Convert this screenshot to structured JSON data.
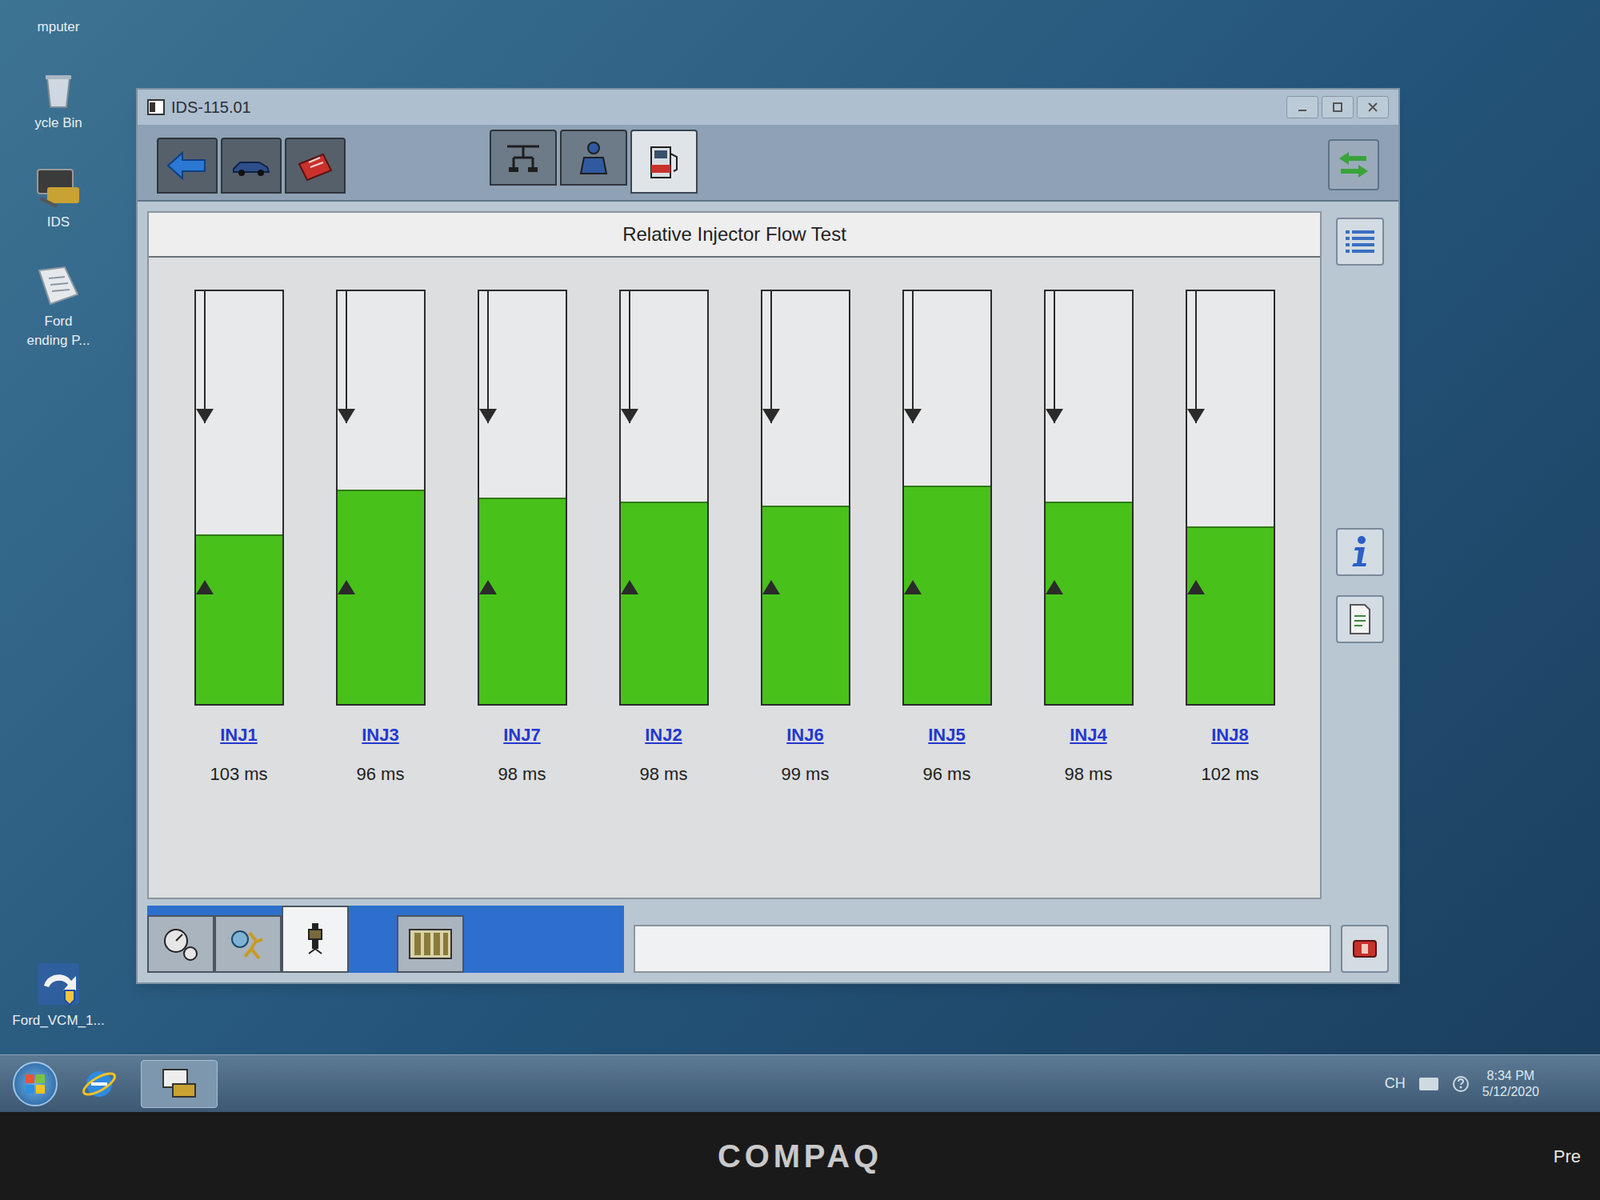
{
  "desktop": {
    "icons": [
      {
        "kind": "computer",
        "lines": [
          "mputer"
        ]
      },
      {
        "kind": "recycle-bin",
        "lines": [
          "ycle Bin"
        ]
      },
      {
        "kind": "ids",
        "lines": [
          "IDS"
        ]
      },
      {
        "kind": "ford-app",
        "lines": [
          "Ford",
          "ending P..."
        ]
      },
      {
        "kind": "vcm",
        "lines": [
          "Ford_VCM_1..."
        ]
      }
    ]
  },
  "window": {
    "title": "IDS-115.01"
  },
  "toolbar": {
    "left_buttons": [
      {
        "kind": "back"
      },
      {
        "kind": "vehicle"
      },
      {
        "kind": "toolbox"
      }
    ],
    "tabs": [
      {
        "kind": "hoist",
        "selected": false
      },
      {
        "kind": "technician",
        "selected": false
      },
      {
        "kind": "fuel-pump",
        "selected": true
      }
    ]
  },
  "panel": {
    "title": "Relative Injector Flow Test"
  },
  "chart": {
    "limits": {
      "upper": 0.68,
      "lower": 0.3
    },
    "injectors": [
      {
        "label": "INJ1",
        "reading": "103 ms",
        "level": 0.41
      },
      {
        "label": "INJ3",
        "reading": "96 ms",
        "level": 0.52
      },
      {
        "label": "INJ7",
        "reading": "98 ms",
        "level": 0.5
      },
      {
        "label": "INJ2",
        "reading": "98 ms",
        "level": 0.49
      },
      {
        "label": "INJ6",
        "reading": "99 ms",
        "level": 0.48
      },
      {
        "label": "INJ5",
        "reading": "96 ms",
        "level": 0.53
      },
      {
        "label": "INJ4",
        "reading": "98 ms",
        "level": 0.49
      },
      {
        "label": "INJ8",
        "reading": "102 ms",
        "level": 0.43
      }
    ]
  },
  "bottom_tabs": [
    {
      "kind": "gauges",
      "selected": false
    },
    {
      "kind": "runner",
      "selected": false
    },
    {
      "kind": "injector",
      "selected": true
    },
    {
      "kind": "injector-bank",
      "selected": false
    }
  ],
  "taskbar": {
    "tray": {
      "lang": "CH",
      "time": "8:34 PM",
      "date": "5/12/2020"
    }
  },
  "bezel": {
    "brand": "COMPAQ",
    "edge_text": "Pre"
  }
}
